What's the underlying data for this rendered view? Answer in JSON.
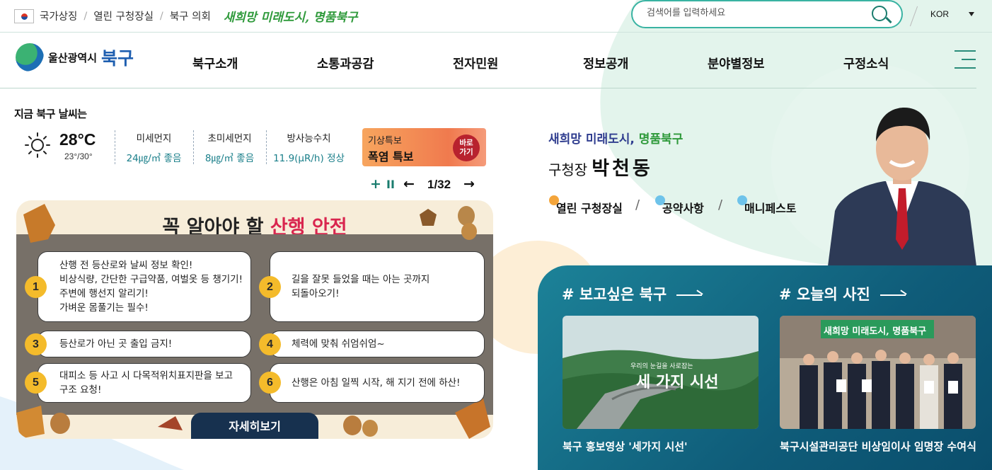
{
  "top": {
    "links": [
      "국가상징",
      "열린 구청장실",
      "북구 의회"
    ],
    "slogan": "새희망 미래도시, 명품북구",
    "search_placeholder": "검색어를 입력하세요",
    "lang": "KOR"
  },
  "logo": {
    "city": "울산광역시",
    "district": "북구"
  },
  "nav": {
    "items": [
      "북구소개",
      "소통과공감",
      "전자민원",
      "정보공개",
      "분야별정보",
      "구정소식"
    ]
  },
  "weather": {
    "title": "지금 북구 날씨는",
    "temp": "28°C",
    "range": "23°/30°",
    "aq": [
      {
        "label": "미세먼지",
        "value": "24㎍/㎥",
        "status": "좋음"
      },
      {
        "label": "초미세먼지",
        "value": "8㎍/㎥",
        "status": "좋음"
      },
      {
        "label": "방사능수치",
        "value": "11.9(μR/h)",
        "status": "정상"
      }
    ],
    "alert_label": "기상특보",
    "alert_value": "폭염 특보",
    "alert_go": "바로가기"
  },
  "slider": {
    "page": "1/32"
  },
  "banner": {
    "title_a": "꼭 알아야 할 ",
    "title_b": "산행 안전",
    "items": [
      {
        "num": "1",
        "text": "산행 전 등산로와 날씨 정보 확인!\n비상식량, 간단한 구급약품, 여벌옷 등 챙기기!\n주변에 행선지 알리기!\n가벼운 몸풀기는 필수!"
      },
      {
        "num": "2",
        "text": "길을 잘못 들었을 때는 아는 곳까지\n되돌아오기!"
      },
      {
        "num": "3",
        "text": "등산로가 아닌 곳 출입 금지!"
      },
      {
        "num": "4",
        "text": "체력에 맞춰 쉬엄쉬엄~"
      },
      {
        "num": "5",
        "text": "대피소 등 사고 시 다목적위치표지판을 보고\n구조 요청!"
      },
      {
        "num": "6",
        "text": "산행은 아침 일찍 시작, 해 지기 전에 하산!"
      }
    ],
    "more": "자세히보기"
  },
  "mayor": {
    "greet_a": "새희망 미래도시, ",
    "greet_b": "명품북구",
    "title": "구청장",
    "name": "박천동",
    "links": [
      "열린 구청장실",
      "공약사항",
      "매니페스토"
    ]
  },
  "panel": {
    "sec1": "# 보고싶은 북구",
    "sec2": "# 오늘의 사진",
    "cap1": "북구 홍보영상 '세가지 시선'",
    "cap2": "북구시설관리공단 비상임이사 임명장 수여식",
    "thumb1_small": "우리의 눈길을 사로잡는",
    "thumb1_big": "세 가지 시선",
    "thumb2_banner": "새희망 미래도시, 명품북구"
  },
  "colors": {
    "teal": "#1a7c6e",
    "panel": "#0f5c79",
    "badge": "#f4bb2b",
    "alert": "#f07a4e"
  }
}
